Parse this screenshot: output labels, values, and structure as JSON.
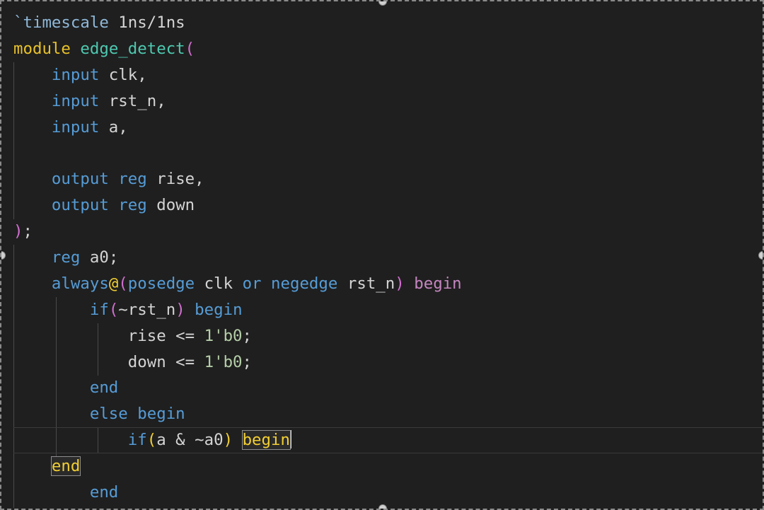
{
  "editor": {
    "lines": [
      {
        "segments": [
          {
            "t": "`timescale",
            "c": "dir"
          },
          {
            "t": " 1ns/1ns",
            "c": "txt"
          }
        ]
      },
      {
        "segments": [
          {
            "t": "module",
            "c": "mod"
          },
          {
            "t": " ",
            "c": "txt"
          },
          {
            "t": "edge_detect",
            "c": "fn"
          },
          {
            "t": "(",
            "c": "br"
          }
        ]
      },
      {
        "segments": [
          {
            "t": "    ",
            "c": "txt"
          },
          {
            "t": "input",
            "c": "kw"
          },
          {
            "t": " clk,",
            "c": "txt"
          }
        ]
      },
      {
        "segments": [
          {
            "t": "    ",
            "c": "txt"
          },
          {
            "t": "input",
            "c": "kw"
          },
          {
            "t": " rst_n,",
            "c": "txt"
          }
        ]
      },
      {
        "segments": [
          {
            "t": "    ",
            "c": "txt"
          },
          {
            "t": "input",
            "c": "kw"
          },
          {
            "t": " a,",
            "c": "txt"
          }
        ]
      },
      {
        "segments": []
      },
      {
        "segments": [
          {
            "t": "    ",
            "c": "txt"
          },
          {
            "t": "output",
            "c": "kw"
          },
          {
            "t": " ",
            "c": "txt"
          },
          {
            "t": "reg",
            "c": "kw"
          },
          {
            "t": " rise,",
            "c": "txt"
          }
        ]
      },
      {
        "segments": [
          {
            "t": "    ",
            "c": "txt"
          },
          {
            "t": "output",
            "c": "kw"
          },
          {
            "t": " ",
            "c": "txt"
          },
          {
            "t": "reg",
            "c": "kw"
          },
          {
            "t": " down",
            "c": "txt"
          }
        ]
      },
      {
        "segments": [
          {
            "t": ")",
            "c": "br"
          },
          {
            "t": ";",
            "c": "txt"
          }
        ]
      },
      {
        "segments": [
          {
            "t": "    ",
            "c": "txt"
          },
          {
            "t": "reg",
            "c": "kw"
          },
          {
            "t": " a0;",
            "c": "txt"
          }
        ]
      },
      {
        "segments": [
          {
            "t": "    ",
            "c": "txt"
          },
          {
            "t": "always",
            "c": "kw"
          },
          {
            "t": "@",
            "c": "gold"
          },
          {
            "t": "(",
            "c": "br"
          },
          {
            "t": "posedge",
            "c": "kw"
          },
          {
            "t": " clk ",
            "c": "txt"
          },
          {
            "t": "or",
            "c": "kw"
          },
          {
            "t": " ",
            "c": "txt"
          },
          {
            "t": "negedge",
            "c": "kw"
          },
          {
            "t": " rst_n",
            "c": "txt"
          },
          {
            "t": ")",
            "c": "br"
          },
          {
            "t": " ",
            "c": "txt"
          },
          {
            "t": "begin",
            "c": "kw2"
          }
        ]
      },
      {
        "segments": [
          {
            "t": "        ",
            "c": "txt"
          },
          {
            "t": "if",
            "c": "kw"
          },
          {
            "t": "(",
            "c": "br"
          },
          {
            "t": "~rst_n",
            "c": "txt"
          },
          {
            "t": ")",
            "c": "br"
          },
          {
            "t": " ",
            "c": "txt"
          },
          {
            "t": "begin",
            "c": "kw"
          }
        ]
      },
      {
        "segments": [
          {
            "t": "            rise <= ",
            "c": "txt"
          },
          {
            "t": "1'b0",
            "c": "num"
          },
          {
            "t": ";",
            "c": "txt"
          }
        ]
      },
      {
        "segments": [
          {
            "t": "            down <= ",
            "c": "txt"
          },
          {
            "t": "1'b0",
            "c": "num"
          },
          {
            "t": ";",
            "c": "txt"
          }
        ]
      },
      {
        "segments": [
          {
            "t": "        ",
            "c": "txt"
          },
          {
            "t": "end",
            "c": "kw"
          }
        ]
      },
      {
        "segments": [
          {
            "t": "        ",
            "c": "txt"
          },
          {
            "t": "else",
            "c": "kw"
          },
          {
            "t": " ",
            "c": "txt"
          },
          {
            "t": "begin",
            "c": "kw"
          }
        ]
      },
      {
        "current": true,
        "segments": [
          {
            "t": "            ",
            "c": "txt"
          },
          {
            "t": "if",
            "c": "kw"
          },
          {
            "t": "(",
            "c": "gold"
          },
          {
            "t": "a & ~a0",
            "c": "txt"
          },
          {
            "t": ")",
            "c": "gold"
          },
          {
            "t": " ",
            "c": "txt"
          },
          {
            "t": "begin",
            "c": "box"
          },
          {
            "t": "",
            "c": "cursor"
          }
        ]
      },
      {
        "segments": [
          {
            "t": "    ",
            "c": "txt"
          },
          {
            "t": "end",
            "c": "box"
          }
        ]
      },
      {
        "segments": [
          {
            "t": "        ",
            "c": "txt"
          },
          {
            "t": "end",
            "c": "kw"
          }
        ]
      }
    ]
  },
  "colors": {
    "background": "#1f1f1f",
    "keyword": "#569cd6",
    "keyword_control": "#c586c0",
    "module": "#e8c12a",
    "identifier": "#4ec9b0",
    "number": "#b5cea8",
    "bracket": "#d16fd0"
  }
}
